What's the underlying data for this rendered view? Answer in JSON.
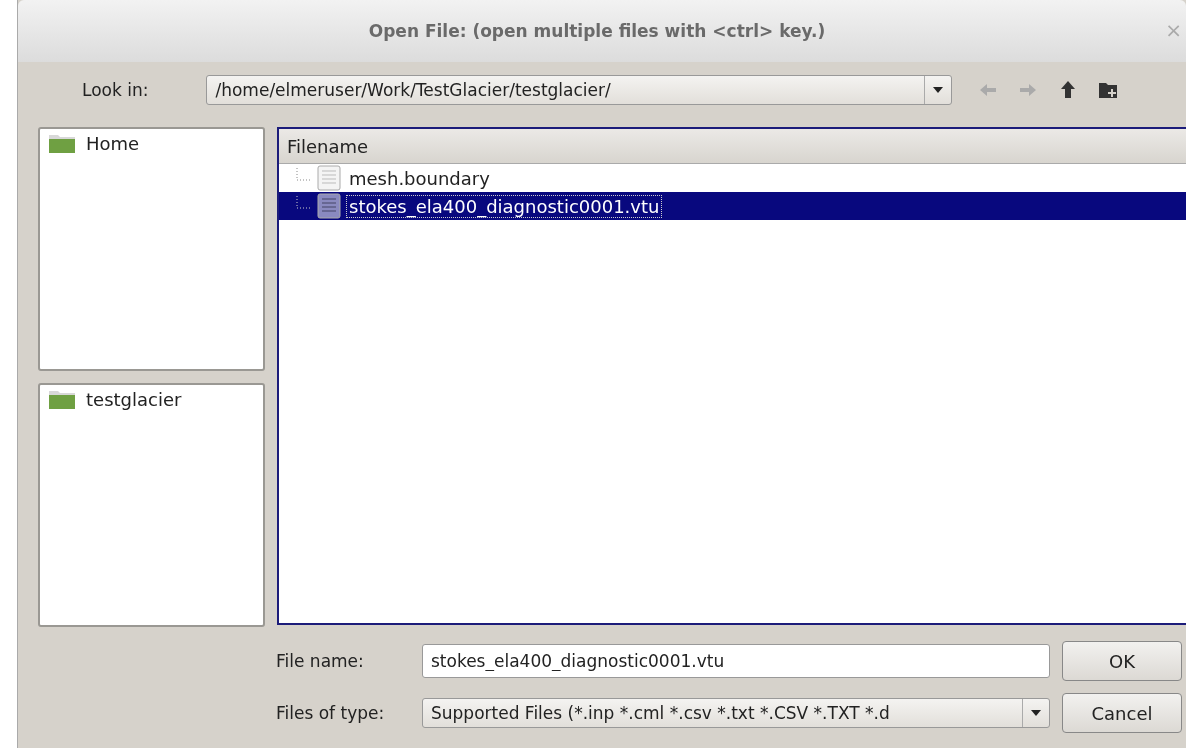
{
  "window": {
    "title": "Open File:  (open multiple files with <ctrl> key.)",
    "close": "×"
  },
  "look_in": {
    "label": "Look in:",
    "value": "/home/elmeruser/Work/TestGlacier/testglacier/"
  },
  "places": [
    {
      "label": "Home"
    }
  ],
  "recent": [
    {
      "label": "testglacier"
    }
  ],
  "file_list": {
    "column": "Filename",
    "rows": [
      {
        "name": "mesh.boundary",
        "selected": false
      },
      {
        "name": "stokes_ela400_diagnostic0001.vtu",
        "selected": true
      }
    ]
  },
  "file_name": {
    "label": "File name:",
    "value": "stokes_ela400_diagnostic0001.vtu"
  },
  "file_type": {
    "label": "Files of type:",
    "value": "Supported Files (*.inp  *.cml  *.csv *.txt *.CSV *.TXT  *.d"
  },
  "buttons": [
    {
      "label": "OK"
    },
    {
      "label": "Cancel"
    }
  ]
}
